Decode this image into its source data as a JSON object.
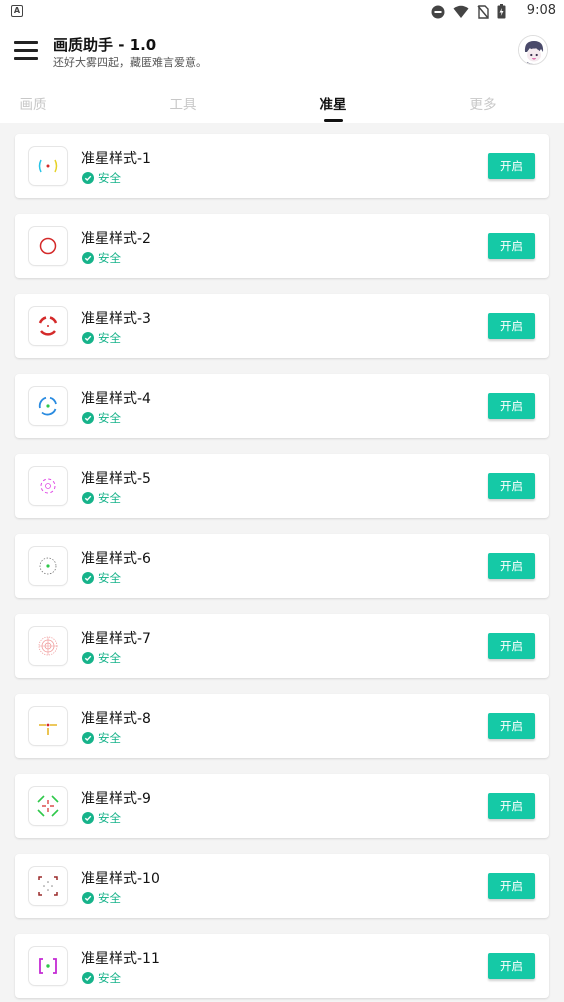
{
  "status_bar": {
    "time": "9:08",
    "notification_icon": "a-notification-icon",
    "icons": [
      "do-not-disturb-icon",
      "wifi-icon",
      "no-sim-icon",
      "battery-charging-icon"
    ]
  },
  "header": {
    "title": "画质助手 - 1.0",
    "subtitle": "还好大雾四起，藏匿难言爱意。",
    "menu_icon": "hamburger-menu-icon",
    "avatar": "avatar-anime-icon"
  },
  "tabs": [
    {
      "label": "画质",
      "active": false
    },
    {
      "label": "工具",
      "active": false
    },
    {
      "label": "准星",
      "active": true
    },
    {
      "label": "更多",
      "active": false
    }
  ],
  "colors": {
    "accent": "#15c9a6",
    "safe_green": "#16b38a",
    "background": "#f4f4f4"
  },
  "items": [
    {
      "title": "准星样式-1",
      "status": "安全",
      "button": "开启",
      "icon": "crosshair-style-1-icon"
    },
    {
      "title": "准星样式-2",
      "status": "安全",
      "button": "开启",
      "icon": "crosshair-style-2-icon"
    },
    {
      "title": "准星样式-3",
      "status": "安全",
      "button": "开启",
      "icon": "crosshair-style-3-icon"
    },
    {
      "title": "准星样式-4",
      "status": "安全",
      "button": "开启",
      "icon": "crosshair-style-4-icon"
    },
    {
      "title": "准星样式-5",
      "status": "安全",
      "button": "开启",
      "icon": "crosshair-style-5-icon"
    },
    {
      "title": "准星样式-6",
      "status": "安全",
      "button": "开启",
      "icon": "crosshair-style-6-icon"
    },
    {
      "title": "准星样式-7",
      "status": "安全",
      "button": "开启",
      "icon": "crosshair-style-7-icon"
    },
    {
      "title": "准星样式-8",
      "status": "安全",
      "button": "开启",
      "icon": "crosshair-style-8-icon"
    },
    {
      "title": "准星样式-9",
      "status": "安全",
      "button": "开启",
      "icon": "crosshair-style-9-icon"
    },
    {
      "title": "准星样式-10",
      "status": "安全",
      "button": "开启",
      "icon": "crosshair-style-10-icon"
    },
    {
      "title": "准星样式-11",
      "status": "安全",
      "button": "开启",
      "icon": "crosshair-style-11-icon"
    }
  ]
}
